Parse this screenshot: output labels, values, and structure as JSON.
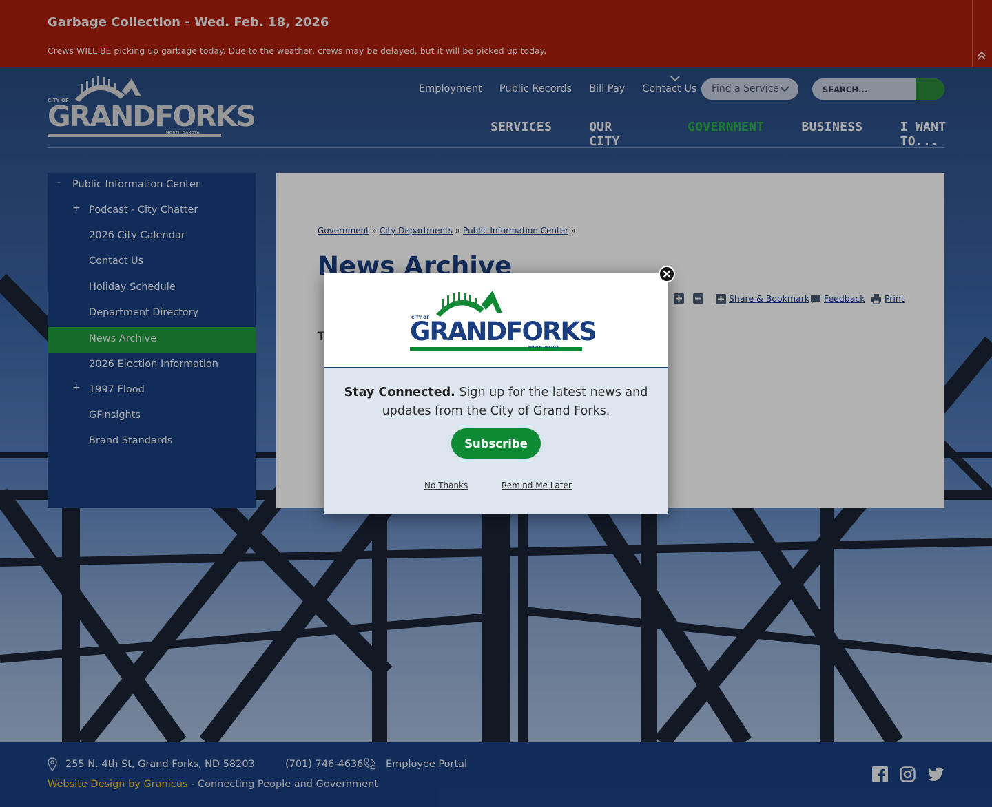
{
  "alert": {
    "title": "Garbage Collection - Wed. Feb. 18, 2026",
    "message": "Crews WILL BE picking up garbage today.  Due to the weather, crews may be delayed, but it will be picked up today."
  },
  "logo": {
    "city_of": "CITY OF",
    "name_grand": "GRAND",
    "name_forks": "FORKS",
    "state": "NORTH DAKOTA"
  },
  "utility_nav": [
    "Employment",
    "Public Records",
    "Bill Pay",
    "Contact Us"
  ],
  "find_service": "Find a Service",
  "search": {
    "placeholder": "SEARCH..."
  },
  "main_nav": [
    {
      "label": "SERVICES"
    },
    {
      "label": "OUR CITY"
    },
    {
      "label": "GOVERNMENT"
    },
    {
      "label": "BUSINESS"
    },
    {
      "label": "I WANT TO..."
    }
  ],
  "sidebar": {
    "parent": {
      "toggle": "-",
      "label": "Public Information Center"
    },
    "items": [
      {
        "label": "Podcast - City Chatter",
        "toggle": "+"
      },
      {
        "label": "2026 City Calendar"
      },
      {
        "label": "Contact Us"
      },
      {
        "label": "Holiday Schedule"
      },
      {
        "label": "Department Directory"
      },
      {
        "label": "News Archive"
      },
      {
        "label": "2026 Election Information"
      },
      {
        "label": "1997 Flood",
        "toggle": "+"
      },
      {
        "label": "GFinsights"
      },
      {
        "label": "Brand Standards"
      }
    ]
  },
  "breadcrumb": [
    "Government",
    "City Departments",
    "Public Information Center"
  ],
  "breadcrumb_sep": "»",
  "page_title": "News Archive",
  "tools": {
    "share": "Share & Bookmark",
    "feedback": "Feedback",
    "print": "Print"
  },
  "content_text": "T",
  "modal": {
    "lead": "Stay Connected.",
    "text": " Sign up for the latest news and updates from the City of Grand Forks.",
    "subscribe": "Subscribe",
    "no_thanks": "No Thanks",
    "remind_later": "Remind Me Later"
  },
  "footer": {
    "address": "255 N. 4th St, Grand Forks, ND 58203",
    "phone": "(701) 746-4636",
    "employee_portal": "Employee Portal",
    "credit_link": "Website Design by Granicus",
    "credit_tail": " - Connecting People and Government"
  },
  "colors": {
    "alert": "#ad1f0e",
    "navy": "#1b3e80",
    "green": "#0f8a34",
    "credit": "#f4c21f"
  }
}
